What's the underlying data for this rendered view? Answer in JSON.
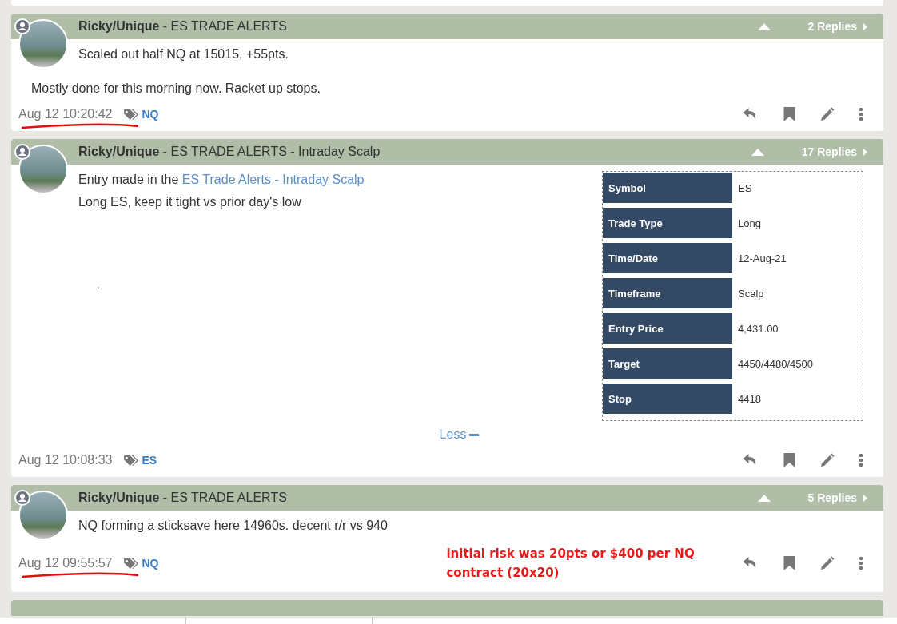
{
  "posts": [
    {
      "author": "Ricky/Unique",
      "channel": " - ES TRADE ALERTS",
      "replies": "2 Replies",
      "paragraphs": [
        {
          "kind": "main",
          "text": "Scaled out half NQ at 15015, +55pts."
        },
        {
          "kind": "wide",
          "text": "Mostly done for this morning now. Racket up stops."
        }
      ],
      "time": "Aug 12 10:20:42",
      "tag": "NQ",
      "time_underlined": true
    },
    {
      "author": "Ricky/Unique",
      "channel": " - ES TRADE ALERTS - Intraday Scalp",
      "replies": "17 Replies",
      "paragraphs": [
        {
          "kind": "link",
          "text": "Entry made in the ",
          "link": "ES Trade Alerts - Intraday Scalp"
        },
        {
          "kind": "main",
          "text": "Long ES, keep it tight vs prior day's low"
        },
        {
          "kind": "dot",
          "text": "."
        }
      ],
      "table": [
        {
          "label": "Symbol",
          "value": "ES"
        },
        {
          "label": "Trade Type",
          "value": "Long"
        },
        {
          "label": "Time/Date",
          "value": "12-Aug-21"
        },
        {
          "label": "Timeframe",
          "value": "Scalp"
        },
        {
          "label": "Entry Price",
          "value": "4,431.00"
        },
        {
          "label": "Target",
          "value": "4450/4480/4500"
        },
        {
          "label": "Stop",
          "value": "4418"
        }
      ],
      "toggle": "Less",
      "time": "Aug 12 10:08:33",
      "tag": "ES",
      "time_underlined": false
    },
    {
      "author": "Ricky/Unique",
      "channel": " - ES TRADE ALERTS",
      "replies": "5 Replies",
      "paragraphs": [
        {
          "kind": "main",
          "text": "NQ forming a sticksave here 14960s. decent r/r vs 940"
        }
      ],
      "time": "Aug 12 09:55:57",
      "tag": "NQ",
      "time_underlined": true,
      "annotation": "initial risk was 20pts or $400 per NQ contract (20x20)"
    }
  ]
}
